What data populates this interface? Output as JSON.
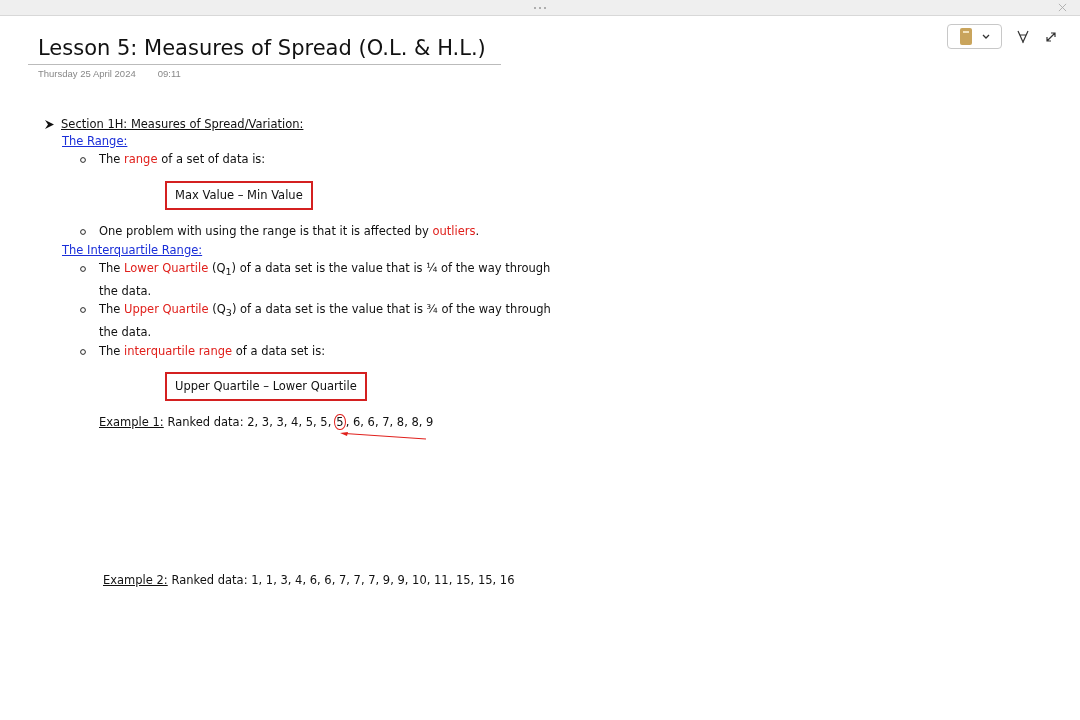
{
  "title": "Lesson 5: Measures of Spread (O.L. & H.L.)",
  "date": "Thursday 25 April 2024",
  "time": "09:11",
  "section": "Section 1H: Measures of Spread/Variation:",
  "blocks": [
    {
      "kind": "heading",
      "text": "The Range:"
    },
    {
      "kind": "bullet",
      "segments": [
        {
          "kind": "plain",
          "text": "The "
        },
        {
          "kind": "red",
          "text": "range"
        },
        {
          "kind": "plain",
          "text": " of a set of data is:"
        }
      ]
    },
    {
      "kind": "formula",
      "text": "Max Value – Min Value"
    },
    {
      "kind": "bullet",
      "segments": [
        {
          "kind": "plain",
          "text": "One problem with using the range is that it is affected by "
        },
        {
          "kind": "red",
          "text": "outliers"
        },
        {
          "kind": "plain",
          "text": "."
        }
      ]
    },
    {
      "kind": "heading",
      "text": "The Interquartile Range:"
    },
    {
      "kind": "bullet",
      "segments": [
        {
          "kind": "plain",
          "text": "The "
        },
        {
          "kind": "red",
          "text": "Lower Quartile"
        },
        {
          "kind": "plain",
          "text": " (Q$_{1}$) of a data set is the value that is ¼ of the way through the data."
        }
      ]
    },
    {
      "kind": "bullet",
      "segments": [
        {
          "kind": "plain",
          "text": "The "
        },
        {
          "kind": "red",
          "text": "Upper Quartile"
        },
        {
          "kind": "plain",
          "text": " (Q$_{3}$) of a data set is the value that is ¾ of the way through the data."
        }
      ]
    },
    {
      "kind": "bullet",
      "segments": [
        {
          "kind": "plain",
          "text": "The "
        },
        {
          "kind": "red",
          "text": "interquartile range"
        },
        {
          "kind": "plain",
          "text": " of a data set is:"
        }
      ]
    },
    {
      "kind": "formula",
      "text": "Upper Quartile – Lower Quartile"
    }
  ],
  "example1": {
    "label": "Example 1:",
    "intro": " Ranked data: 2, 3, 3, 4, 5, 5,",
    "circled": "5",
    "rest": ", 6, 6, 7, 8, 8, 9"
  },
  "example2": {
    "label": "Example 2:",
    "intro": " Ranked data: 1, 1, 3, 4, 6, 6, 7, 7, 7, 9, 9, 10, 11, 15, 15, 16"
  }
}
